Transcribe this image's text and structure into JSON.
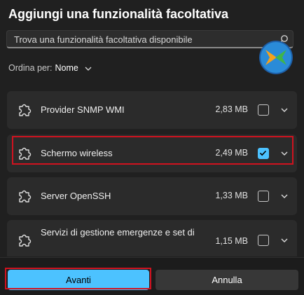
{
  "dialog": {
    "title": "Aggiungi una funzionalità facoltativa"
  },
  "search": {
    "placeholder": "Trova una funzionalità facoltativa disponibile",
    "value": ""
  },
  "sort": {
    "label": "Ordina per:",
    "value": "Nome"
  },
  "features": [
    {
      "name": "Provider SNMP WMI",
      "size": "2,83 MB",
      "checked": false
    },
    {
      "name": "Schermo wireless",
      "size": "2,49 MB",
      "checked": true
    },
    {
      "name": "Server OpenSSH",
      "size": "1,33 MB",
      "checked": false
    },
    {
      "name": "Servizi di gestione emergenze e set di",
      "size": "1,15 MB",
      "checked": false
    }
  ],
  "footer": {
    "next_label": "Avanti",
    "cancel_label": "Annulla"
  },
  "colors": {
    "accent": "#4cc2ff",
    "highlight": "#d0121f",
    "background": "#202020",
    "row": "#2b2b2b"
  }
}
